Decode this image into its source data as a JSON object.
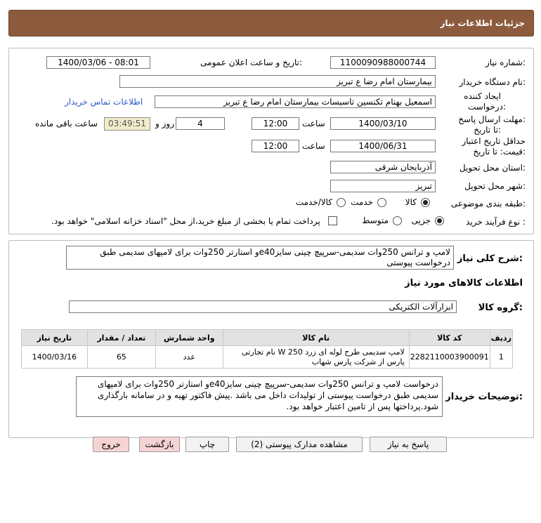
{
  "header": {
    "title": "جزئیات اطلاعات نیاز"
  },
  "info": {
    "need_number_label": "شماره نیاز:",
    "need_number": "1100090988000744",
    "announce_label": "تاریخ و ساعت اعلان عمومی:",
    "announce_value": "1400/03/06 - 08:01",
    "buyer_label": "نام دستگاه خریدار:",
    "buyer_value": "بیمارستان امام رضا  ع  تبریز",
    "creator_label_1": "ایجاد کننده",
    "creator_label_2": "درخواست:",
    "creator_value": "اسمعیل بهنام تکنسین تاسیسات بیمارستان امام رضا  ع  تبریز",
    "contact_link": "اطلاعات تماس خریدار",
    "send_deadline_label_1": "مهلت ارسال پاسخ:",
    "send_deadline_label_2": "تا تاریخ:",
    "send_date": "1400/03/10",
    "time_label": "ساعت",
    "send_time": "12:00",
    "days_value": "4",
    "days_label": "روز و",
    "timer": "03:49:51",
    "remaining_label": "ساعت باقی مانده",
    "validity_label_1": "حداقل تاریخ اعتبار",
    "validity_label_2": "قیمت: تا تاریخ:",
    "validity_date": "1400/06/31",
    "validity_time": "12:00",
    "province_label": "استان محل تحویل:",
    "province_value": "آذربایجان شرقی",
    "city_label": "شهر محل تحویل:",
    "city_value": "تبریز",
    "category_label": "طبقه بندی موضوعی:",
    "category_options": [
      "کالا",
      "خدمت",
      "کالا/خدمت"
    ],
    "process_label": "نوع فرآیند خرید :",
    "process_options": [
      "جزیی",
      "متوسط"
    ],
    "payment_text": "پرداخت تمام یا بخشی از مبلغ خرید،از محل \"اسناد خزانه اسلامی\" خواهد بود."
  },
  "summary": {
    "label": "شرح کلی نیاز:",
    "value": "لامپ و ترانس 250وات سدیمی-سرپیچ چینی سایزe40و استارتر 250وات برای لامپهای سدیمی طبق درخواست پیوستی"
  },
  "goods": {
    "section_title": "اطلاعات کالاهای مورد نیاز",
    "group_label": "گروه کالا:",
    "group_value": "ابزارآلات الکتریکی",
    "columns": [
      "ردیف",
      "کد کالا",
      "نام کالا",
      "واحد شمارش",
      "تعداد / مقدار",
      "تاریخ نیاز"
    ],
    "rows": [
      {
        "index": "1",
        "code": "2282110003900091",
        "name": "لامپ سدیمی طرح لوله ای زرد W 250 نام تجارتی پارس از شرکت پارس شهاب",
        "unit": "عدد",
        "qty": "65",
        "date": "1400/03/16"
      }
    ]
  },
  "buyer_notes": {
    "label": "توضیحات خریدار:",
    "value": "درخواست لامپ و ترانس 250وات سدیمی-سرپیچ چینی سایزe40و استارتر 250وات برای لامپهای سدیمی  طبق درخواست پیوستی از تولیدات داخل می باشد .پیش فاکتور تهیه و در سامانه بارگذاری شود.پرداختها  پس از تامین اعتبار خواهد بود."
  },
  "buttons": {
    "reply": "پاسخ به نیاز",
    "attachments": "مشاهده مدارک پیوستی (2)",
    "print": "چاپ",
    "back": "بازگشت",
    "exit": "خروج"
  },
  "watermark": {
    "line1": "ParsNamadData",
    "line2": "مرکز فرآوری اطلاعات پارس نماد داده ها",
    "line3": "پایگاه اطلاع رسانی مناقصه و مزایده",
    "line4": "۰۲۱-۸۸۳۴۹۶۷۰"
  }
}
